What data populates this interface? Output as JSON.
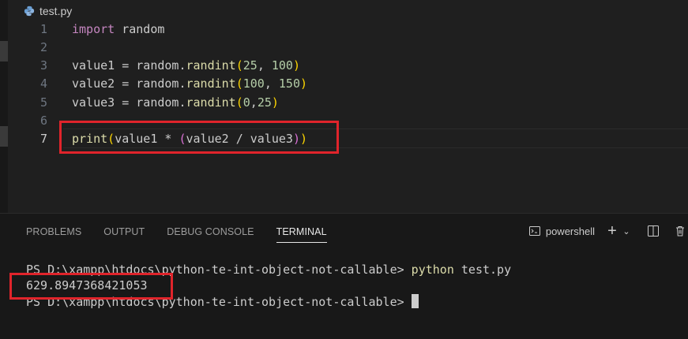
{
  "tab": {
    "filename": "test.py",
    "icon": "python-file-icon"
  },
  "editor": {
    "lines": [
      {
        "num": "1",
        "tokens": [
          {
            "t": "import",
            "c": "kw"
          },
          {
            "t": " random",
            "c": "plain"
          }
        ]
      },
      {
        "num": "2",
        "tokens": []
      },
      {
        "num": "3",
        "tokens": [
          {
            "t": "value1 = random.",
            "c": "plain"
          },
          {
            "t": "randint",
            "c": "fn"
          },
          {
            "t": "(",
            "c": "p1"
          },
          {
            "t": "25",
            "c": "num"
          },
          {
            "t": ", ",
            "c": "plain"
          },
          {
            "t": "100",
            "c": "num"
          },
          {
            "t": ")",
            "c": "p1"
          }
        ]
      },
      {
        "num": "4",
        "tokens": [
          {
            "t": "value2 = random.",
            "c": "plain"
          },
          {
            "t": "randint",
            "c": "fn"
          },
          {
            "t": "(",
            "c": "p1"
          },
          {
            "t": "100",
            "c": "num"
          },
          {
            "t": ", ",
            "c": "plain"
          },
          {
            "t": "150",
            "c": "num"
          },
          {
            "t": ")",
            "c": "p1"
          }
        ]
      },
      {
        "num": "5",
        "tokens": [
          {
            "t": "value3 = random.",
            "c": "plain"
          },
          {
            "t": "randint",
            "c": "fn"
          },
          {
            "t": "(",
            "c": "p1"
          },
          {
            "t": "0",
            "c": "num"
          },
          {
            "t": ",",
            "c": "plain"
          },
          {
            "t": "25",
            "c": "num"
          },
          {
            "t": ")",
            "c": "p1"
          }
        ]
      },
      {
        "num": "6",
        "tokens": []
      },
      {
        "num": "7",
        "tokens": [
          {
            "t": "print",
            "c": "fn"
          },
          {
            "t": "(",
            "c": "p1"
          },
          {
            "t": "value1 * ",
            "c": "plain"
          },
          {
            "t": "(",
            "c": "p2"
          },
          {
            "t": "value2 / value3",
            "c": "plain"
          },
          {
            "t": ")",
            "c": "p2"
          },
          {
            "t": ")",
            "c": "p1"
          }
        ]
      }
    ],
    "active_line": "7"
  },
  "panel": {
    "tabs": [
      "PROBLEMS",
      "OUTPUT",
      "DEBUG CONSOLE",
      "TERMINAL"
    ],
    "active_tab": "TERMINAL",
    "shell_name": "powershell",
    "toolbar_icons": [
      "terminal-icon",
      "add-terminal-icon",
      "chevron-down-icon",
      "split-terminal-icon",
      "trash-icon"
    ]
  },
  "terminal": {
    "prompt1": "PS D:\\xampp\\htdocs\\python-te-int-object-not-callable> ",
    "command_word": "python",
    "command_arg": " test.py",
    "output": "629.8947368421053",
    "prompt2": "PS D:\\xampp\\htdocs\\python-te-int-object-not-callable> "
  },
  "colors": {
    "highlight_box": "#e0242b",
    "keyword": "#c586c0",
    "function": "#dcdcaa",
    "number": "#b5cea8",
    "bracket1": "#ffd700",
    "bracket2": "#da70d6"
  }
}
